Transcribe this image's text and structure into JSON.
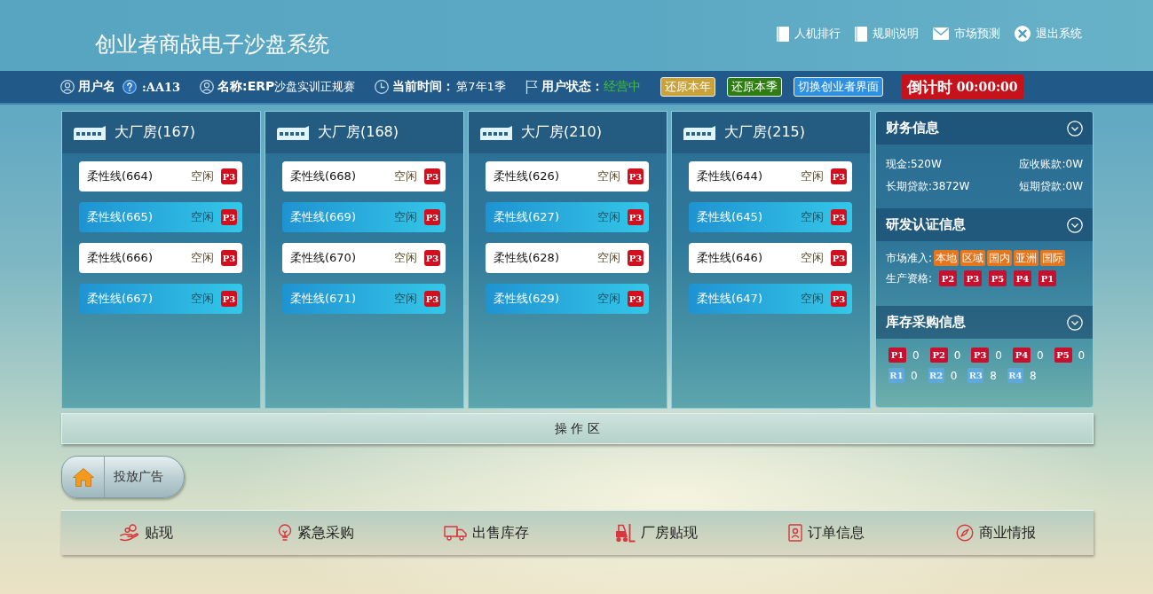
{
  "header": {
    "title": "创业者商战电子沙盘系统",
    "links": [
      "人机排行",
      "规则说明",
      "市场预测",
      "退出系统"
    ]
  },
  "info_bar": {
    "user_label": "用户名",
    "user_value": ":AA13",
    "name": "**名称:ERP**沙盘实训正规赛",
    "time_label": "当前时间：",
    "time_value": "第7年1季",
    "status_label": "用户状态：",
    "status_value": "经营中",
    "buttons": [
      {
        "label": "还原本年",
        "color": "#c9a23c"
      },
      {
        "label": "还原本季",
        "color": "#2f7d12"
      },
      {
        "label": "切换创业者界面",
        "color": "#2e90e0"
      }
    ],
    "countdown": {
      "label": "倒计时",
      "value": "00:00:00"
    }
  },
  "factories": [
    {
      "title": "大厂房(167)",
      "lines": [
        {
          "name": "柔性线(664)",
          "status": "空闲",
          "product": "P3"
        },
        {
          "name": "柔性线(665)",
          "status": "空闲",
          "product": "P3"
        },
        {
          "name": "柔性线(666)",
          "status": "空闲",
          "product": "P3"
        },
        {
          "name": "柔性线(667)",
          "status": "空闲",
          "product": "P3"
        }
      ]
    },
    {
      "title": "大厂房(168)",
      "lines": [
        {
          "name": "柔性线(668)",
          "status": "空闲",
          "product": "P3"
        },
        {
          "name": "柔性线(669)",
          "status": "空闲",
          "product": "P3"
        },
        {
          "name": "柔性线(670)",
          "status": "空闲",
          "product": "P3"
        },
        {
          "name": "柔性线(671)",
          "status": "空闲",
          "product": "P3"
        }
      ]
    },
    {
      "title": "大厂房(210)",
      "lines": [
        {
          "name": "柔性线(626)",
          "status": "空闲",
          "product": "P3"
        },
        {
          "name": "柔性线(627)",
          "status": "空闲",
          "product": "P3"
        },
        {
          "name": "柔性线(628)",
          "status": "空闲",
          "product": "P3"
        },
        {
          "name": "柔性线(629)",
          "status": "空闲",
          "product": "P3"
        }
      ]
    },
    {
      "title": "大厂房(215)",
      "lines": [
        {
          "name": "柔性线(644)",
          "status": "空闲",
          "product": "P3"
        },
        {
          "name": "柔性线(645)",
          "status": "空闲",
          "product": "P3"
        },
        {
          "name": "柔性线(646)",
          "status": "空闲",
          "product": "P3"
        },
        {
          "name": "柔性线(647)",
          "status": "空闲",
          "product": "P3"
        }
      ]
    }
  ],
  "side_panel": {
    "sections": [
      {
        "kind": "finance",
        "title": "财务信息",
        "items": [
          "现金:520W",
          "应收账款:0W",
          "长期贷款:3872W",
          "短期贷款:0W"
        ]
      },
      {
        "kind": "certification",
        "title": "研发认证信息",
        "rows": [
          {
            "kind": "market",
            "label": "市场准入:",
            "tags": [
              "本地",
              "区域",
              "国内",
              "亚洲",
              "国际"
            ]
          },
          {
            "kind": "product",
            "label": "生产资格:",
            "tags": [
              "P2",
              "P3",
              "P5",
              "P4",
              "P1"
            ]
          }
        ]
      },
      {
        "kind": "inventory",
        "title": "库存采购信息",
        "rows": [
          {
            "kind": "product",
            "items": [
              {
                "code": "P1",
                "qty": "0"
              },
              {
                "code": "P2",
                "qty": "0"
              },
              {
                "code": "P3",
                "qty": "0"
              },
              {
                "code": "P4",
                "qty": "0"
              },
              {
                "code": "P5",
                "qty": "0"
              }
            ]
          },
          {
            "kind": "material",
            "items": [
              {
                "code": "R1",
                "qty": "0"
              },
              {
                "code": "R2",
                "qty": "0"
              },
              {
                "code": "R3",
                "qty": "8"
              },
              {
                "code": "R4",
                "qty": "8"
              }
            ]
          }
        ]
      }
    ]
  },
  "operations": {
    "title": "操 作 区",
    "buttons": [
      "投放广告"
    ]
  },
  "toolbar": [
    "贴现",
    "紧急采购",
    "出售库存",
    "厂房贴现",
    "订单信息",
    "商业情报"
  ]
}
